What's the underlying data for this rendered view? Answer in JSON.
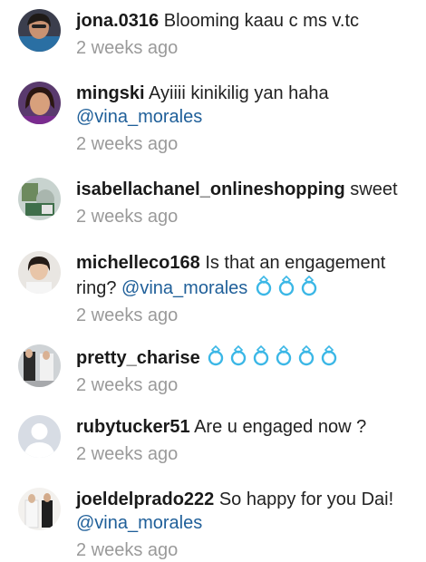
{
  "colors": {
    "mention": "#1f5f99",
    "timestamp": "#9a9a9a",
    "ring": "#3bb7e6"
  },
  "comments": [
    {
      "username": "jona.0316",
      "text": "Blooming kaau c ms v.tc",
      "time": "2 weeks ago"
    },
    {
      "username": "mingski",
      "text": "Ayiiii kinikilig yan haha",
      "mention": "@vina_morales",
      "time": "2 weeks ago"
    },
    {
      "username": "isabellachanel_onlineshopping",
      "text": "sweet",
      "time": "2 weeks ago"
    },
    {
      "username": "michelleco168",
      "text": "Is that an engagement ring?",
      "mention": "@vina_morales",
      "ring_icon": "ring-icon",
      "ring_count": 3,
      "time": "2 weeks ago"
    },
    {
      "username": "pretty_charise",
      "ring_icon": "ring-icon",
      "ring_count": 6,
      "time": "2 weeks ago"
    },
    {
      "username": "rubytucker51",
      "text": "Are u engaged now ?",
      "avatar_icon": "default-user-icon",
      "time": "2 weeks ago"
    },
    {
      "username": "joeldelprado222",
      "text": "So happy for you Dai!",
      "mention": "@vina_morales",
      "time": "2 weeks ago"
    }
  ]
}
